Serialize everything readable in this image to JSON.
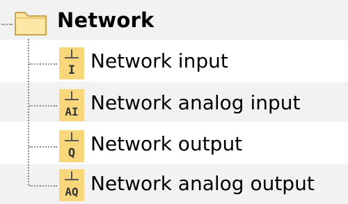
{
  "tree": {
    "root": {
      "label": "Network",
      "icon": "folder-icon",
      "expanded": true
    },
    "children": [
      {
        "label": "Network input",
        "icon_text": "I",
        "icon": "network-input-icon"
      },
      {
        "label": "Network analog input",
        "icon_text": "AI",
        "icon": "network-analog-input-icon"
      },
      {
        "label": "Network output",
        "icon_text": "Q",
        "icon": "network-output-icon"
      },
      {
        "label": "Network analog output",
        "icon_text": "AQ",
        "icon": "network-analog-output-icon"
      }
    ]
  },
  "colors": {
    "row_stripe": "#f2f2f2",
    "folder_fill": "#fbe8a6",
    "folder_stroke": "#c8a24a",
    "icon_fill": "#f7d77a",
    "connector": "#8a8a8a"
  }
}
